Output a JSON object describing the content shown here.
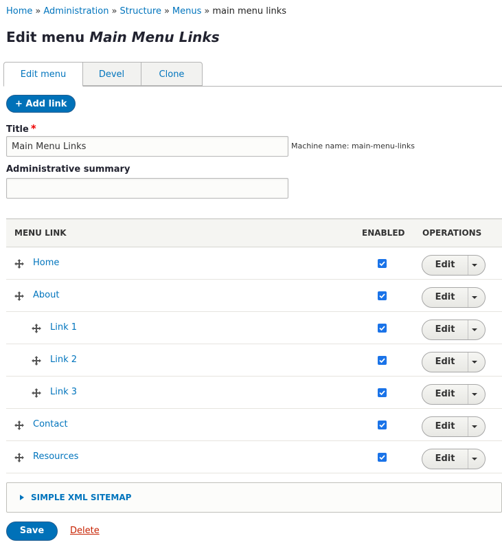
{
  "breadcrumb": {
    "items": [
      "Home",
      "Administration",
      "Structure",
      "Menus"
    ],
    "separator": "»",
    "current": "main menu links"
  },
  "page": {
    "title_prefix": "Edit menu",
    "title_name": "Main Menu Links"
  },
  "tabs": [
    {
      "label": "Edit menu",
      "active": true
    },
    {
      "label": "Devel",
      "active": false
    },
    {
      "label": "Clone",
      "active": false
    }
  ],
  "add_link_button": "+ Add link",
  "form": {
    "title_label": "Title",
    "required_mark": "*",
    "title_value": "Main Menu Links",
    "machine_name": "Machine name: main-menu-links",
    "summary_label": "Administrative summary",
    "summary_value": ""
  },
  "table": {
    "headers": {
      "link": "MENU LINK",
      "enabled": "ENABLED",
      "operations": "OPERATIONS"
    },
    "rows": [
      {
        "label": "Home",
        "depth": 0,
        "enabled": true,
        "op": "Edit"
      },
      {
        "label": "About",
        "depth": 0,
        "enabled": true,
        "op": "Edit"
      },
      {
        "label": "Link 1",
        "depth": 1,
        "enabled": true,
        "op": "Edit"
      },
      {
        "label": "Link 2",
        "depth": 1,
        "enabled": true,
        "op": "Edit"
      },
      {
        "label": "Link 3",
        "depth": 1,
        "enabled": true,
        "op": "Edit"
      },
      {
        "label": "Contact",
        "depth": 0,
        "enabled": true,
        "op": "Edit"
      },
      {
        "label": "Resources",
        "depth": 0,
        "enabled": true,
        "op": "Edit"
      }
    ]
  },
  "sitemap_details": {
    "summary": "SIMPLE XML SITEMAP",
    "expanded": false
  },
  "actions": {
    "save": "Save",
    "delete": "Delete"
  },
  "colors": {
    "link": "#0074bd",
    "primary_button": "#0071b8",
    "delete": "#c72100",
    "required": "#e00000",
    "checkbox": "#1a73e8"
  },
  "icons": [
    "drag-handle-icon",
    "caret-down-icon",
    "checkmark-icon",
    "triangle-right-icon"
  ]
}
